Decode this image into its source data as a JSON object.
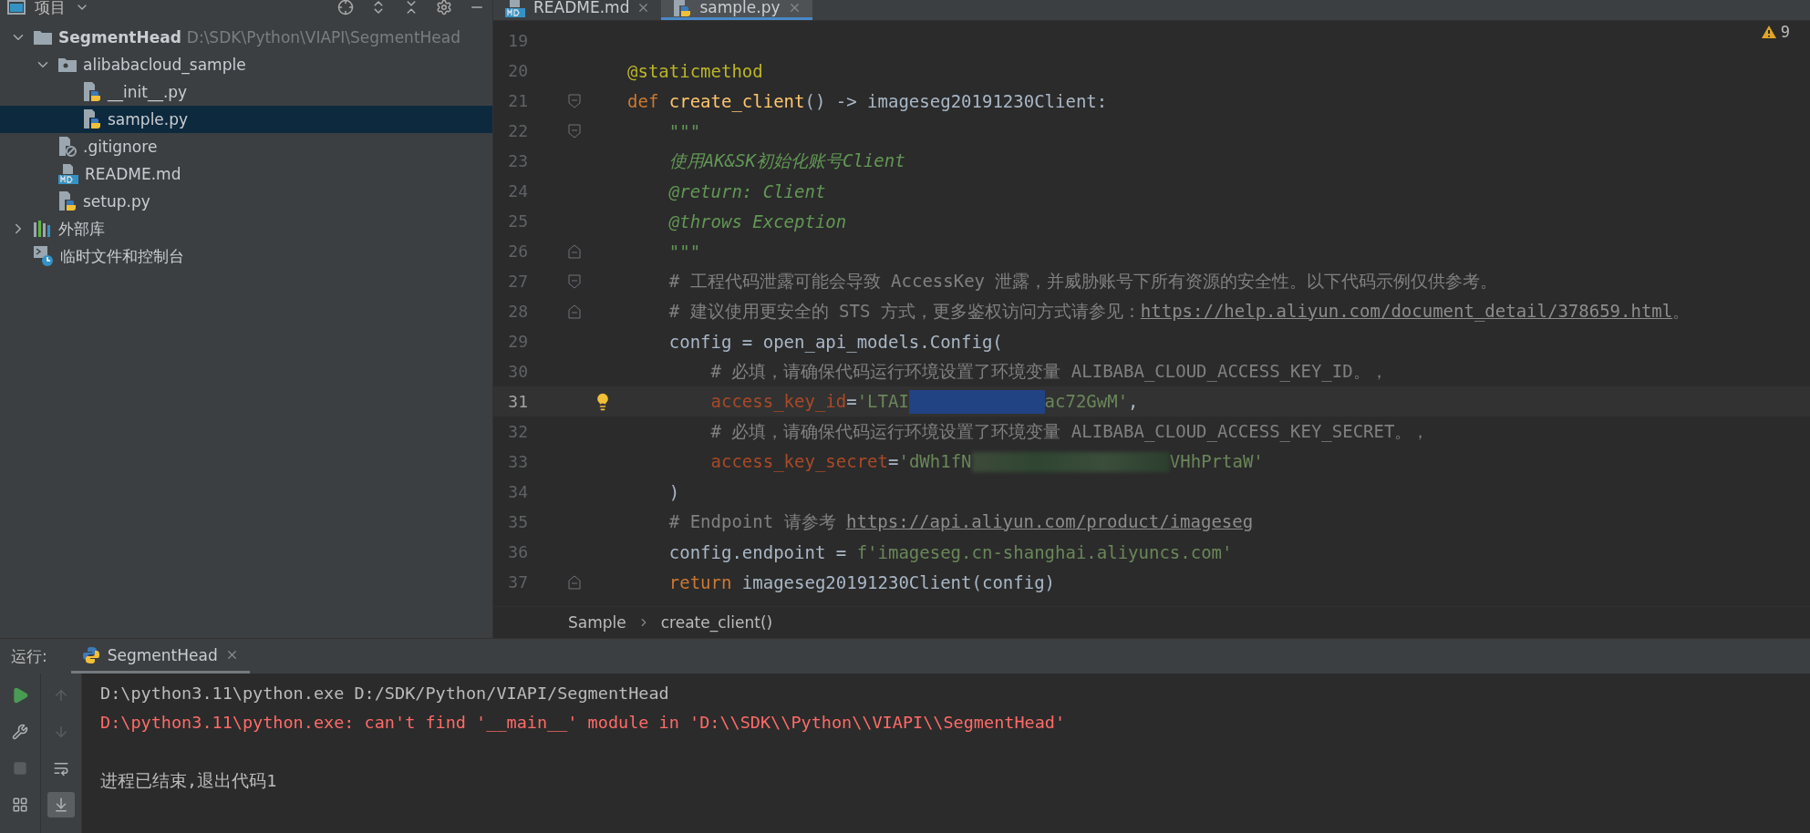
{
  "project_panel": {
    "title": "项目",
    "tree": [
      {
        "kind": "project",
        "label": "SegmentHead",
        "path": "D:\\SDK\\Python\\VIAPI\\SegmentHead",
        "expanded": true,
        "selected": false,
        "children": [
          {
            "kind": "package",
            "label": "alibabacloud_sample",
            "expanded": true,
            "selected": false,
            "children": [
              {
                "kind": "python",
                "label": "__init__.py",
                "selected": false
              },
              {
                "kind": "python",
                "label": "sample.py",
                "selected": true
              }
            ]
          },
          {
            "kind": "ignore",
            "label": ".gitignore",
            "selected": false
          },
          {
            "kind": "markdown",
            "label": "README.md",
            "selected": false
          },
          {
            "kind": "python",
            "label": "setup.py",
            "selected": false
          }
        ]
      },
      {
        "kind": "library",
        "label": "外部库",
        "expanded": false,
        "selected": false
      },
      {
        "kind": "scratch",
        "label": "临时文件和控制台",
        "selected": false
      }
    ]
  },
  "editor": {
    "tabs": [
      {
        "kind": "markdown",
        "label": "README.md",
        "selected": false
      },
      {
        "kind": "python",
        "label": "sample.py",
        "selected": true
      }
    ],
    "warnings": "9",
    "lines": [
      {
        "number": "19",
        "current": false
      },
      {
        "number": "20",
        "current": false,
        "tokens": [
          {
            "kind": "decorator",
            "text": "@staticmethod"
          }
        ]
      },
      {
        "number": "21",
        "current": false,
        "fold": {
          "kind": "start"
        },
        "tokens": [
          {
            "kind": "keyword",
            "text": "def "
          },
          {
            "kind": "func",
            "text": "create_client"
          },
          {
            "kind": "plain",
            "text": "() -> imageseg20191230Client:"
          }
        ]
      },
      {
        "number": "22",
        "current": false,
        "fold": {
          "kind": "start"
        },
        "tokens": [
          {
            "kind": "doc",
            "text": "    \"\"\""
          }
        ]
      },
      {
        "number": "23",
        "current": false,
        "tokens": [
          {
            "kind": "doc",
            "text": "    使用AK&SK初始化账号Client"
          }
        ]
      },
      {
        "number": "24",
        "current": false,
        "tokens": [
          {
            "kind": "doc",
            "text": "    @return: Client"
          }
        ]
      },
      {
        "number": "25",
        "current": false,
        "tokens": [
          {
            "kind": "doc",
            "text": "    @throws Exception"
          }
        ]
      },
      {
        "number": "26",
        "current": false,
        "fold": {
          "kind": "end"
        },
        "tokens": [
          {
            "kind": "doc",
            "text": "    \"\"\""
          }
        ]
      },
      {
        "number": "27",
        "current": false,
        "fold": {
          "kind": "start"
        },
        "tokens": [
          {
            "kind": "comment",
            "text": "    # 工程代码泄露可能会导致 AccessKey 泄露，并威胁账号下所有资源的安全性。以下代码示例仅供参考。"
          }
        ]
      },
      {
        "number": "28",
        "current": false,
        "fold": {
          "kind": "end"
        },
        "tokens": [
          {
            "kind": "comment",
            "text": "    # 建议使用更安全的 STS 方式，更多鉴权访问方式请参见："
          },
          {
            "kind": "link",
            "text": "https://help.aliyun.com/document_detail/378659.html"
          },
          {
            "kind": "comment",
            "text": "。"
          }
        ]
      },
      {
        "number": "29",
        "current": false,
        "tokens": [
          {
            "kind": "plain",
            "text": "    config = open_api_models.Config("
          }
        ]
      },
      {
        "number": "30",
        "current": false,
        "tokens": [
          {
            "kind": "comment",
            "text": "        # 必填，请确保代码运行环境设置了环境变量 ALIBABA_CLOUD_ACCESS_KEY_ID。，"
          }
        ]
      },
      {
        "number": "31",
        "current": true,
        "bulb": true,
        "tokens": [
          {
            "kind": "param",
            "text": "        access_key_id"
          },
          {
            "kind": "plain",
            "text": "="
          },
          {
            "kind": "string",
            "text": "'LTAI"
          },
          {
            "kind": "selection"
          },
          {
            "kind": "string",
            "text": "ac72GwM'"
          },
          {
            "kind": "plain",
            "text": ","
          }
        ]
      },
      {
        "number": "32",
        "current": false,
        "tokens": [
          {
            "kind": "comment",
            "text": "        # 必填，请确保代码运行环境设置了环境变量 ALIBABA_CLOUD_ACCESS_KEY_SECRET。，"
          }
        ]
      },
      {
        "number": "33",
        "current": false,
        "tokens": [
          {
            "kind": "param",
            "text": "        access_key_secret"
          },
          {
            "kind": "plain",
            "text": "="
          },
          {
            "kind": "string",
            "text": "'dWh1fN"
          },
          {
            "kind": "blur"
          },
          {
            "kind": "string",
            "text": "VHhPrtaW'"
          }
        ]
      },
      {
        "number": "34",
        "current": false,
        "tokens": [
          {
            "kind": "plain",
            "text": "    )"
          }
        ]
      },
      {
        "number": "35",
        "current": false,
        "tokens": [
          {
            "kind": "comment",
            "text": "    # Endpoint 请参考 "
          },
          {
            "kind": "link",
            "text": "https://api.aliyun.com/product/imageseg"
          }
        ]
      },
      {
        "number": "36",
        "current": false,
        "tokens": [
          {
            "kind": "plain",
            "text": "    config.endpoint = "
          },
          {
            "kind": "string",
            "text": "f'imageseg.cn-shanghai.aliyuncs.com'"
          }
        ]
      },
      {
        "number": "37",
        "current": false,
        "fold": {
          "kind": "end"
        },
        "tokens": [
          {
            "kind": "keyword",
            "text": "    return "
          },
          {
            "kind": "plain",
            "text": "imageseg20191230Client(config)"
          }
        ]
      }
    ],
    "breadcrumbs": [
      "Sample",
      "create_client()"
    ]
  },
  "run_panel": {
    "label": "运行:",
    "tabs": [
      {
        "label": "SegmentHead",
        "selected": true
      }
    ],
    "output": [
      {
        "kind": "command",
        "text": "D:\\python3.11\\python.exe D:/SDK/Python/VIAPI/SegmentHead"
      },
      {
        "kind": "error",
        "text": "D:\\python3.11\\python.exe: can't find '__main__' module in 'D:\\\\SDK\\\\Python\\\\VIAPI\\\\SegmentHead'"
      },
      {
        "kind": "status",
        "text": "进程已结束,退出代码1"
      }
    ]
  }
}
